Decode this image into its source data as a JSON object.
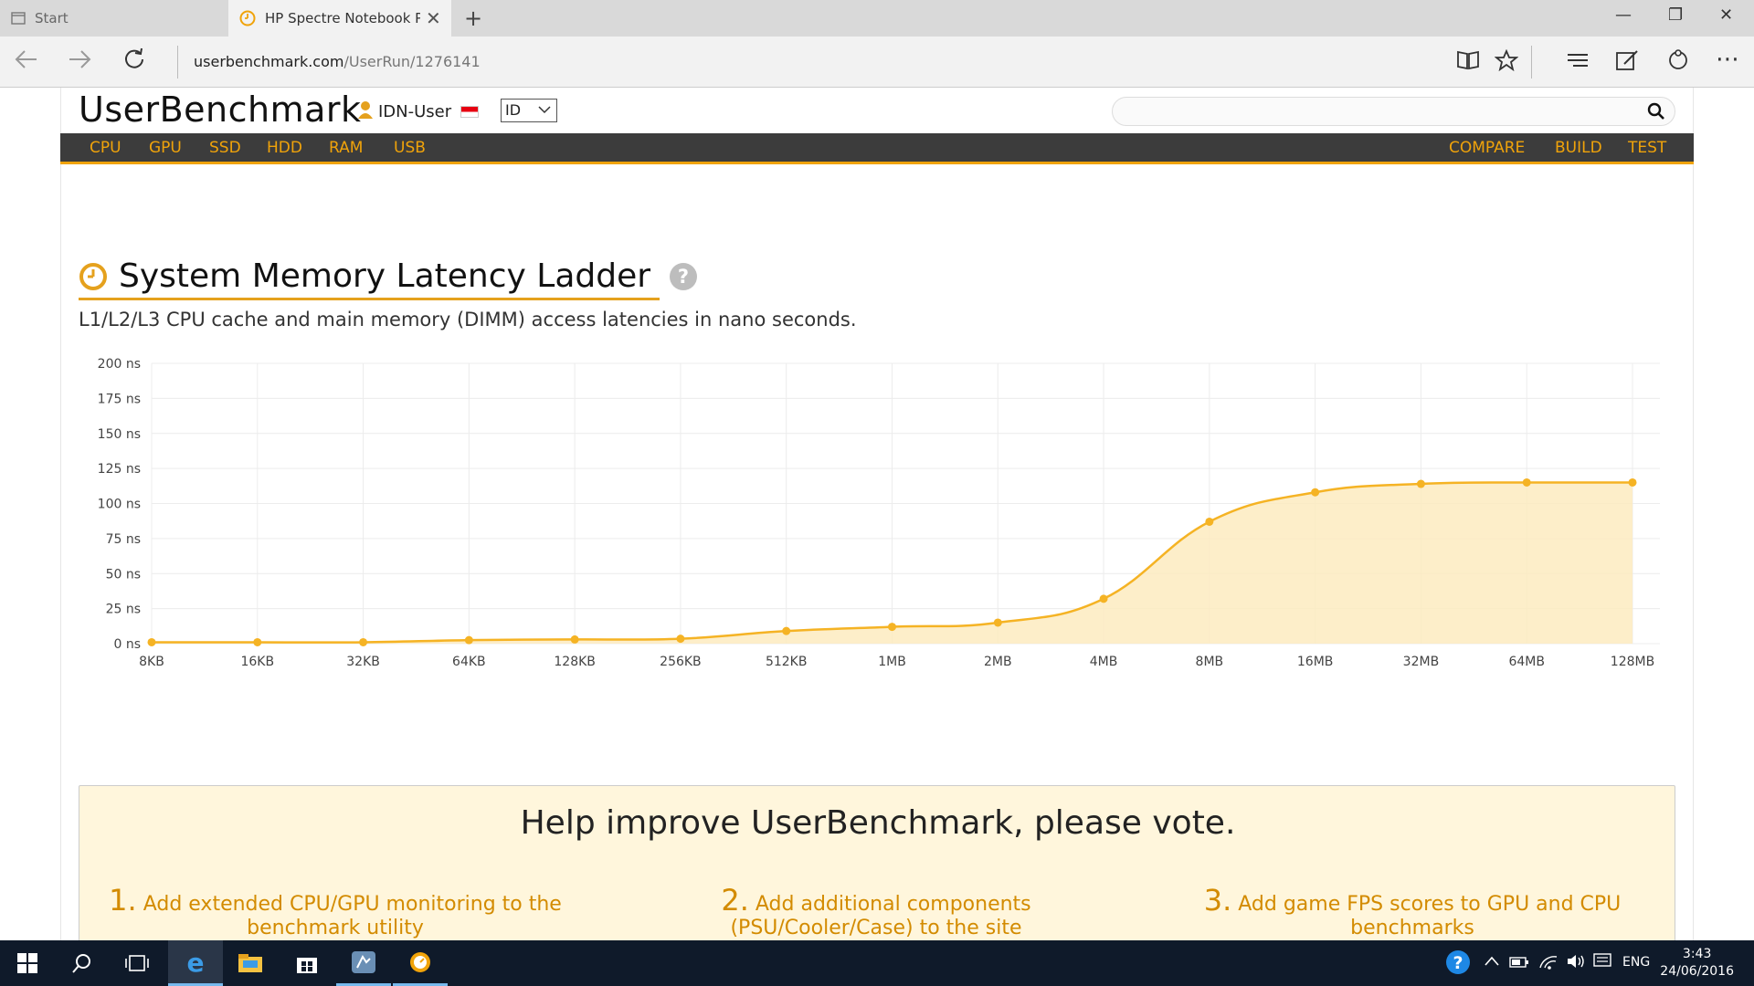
{
  "browser": {
    "tabs": [
      {
        "label": "Start"
      },
      {
        "label": "HP Spectre Notebook P"
      }
    ],
    "url_domain": "userbenchmark.com",
    "url_path": "/UserRun/1276141"
  },
  "site": {
    "logo": "UserBenchmark",
    "user": "IDN-User",
    "lang": "ID",
    "menu_left": [
      "CPU",
      "GPU",
      "SSD",
      "HDD",
      "RAM",
      "USB"
    ],
    "menu_right": [
      "COMPARE",
      "BUILD",
      "TEST"
    ]
  },
  "section": {
    "title": "System Memory Latency Ladder",
    "subtitle": "L1/L2/L3 CPU cache and main memory (DIMM) access latencies in nano seconds."
  },
  "chart_data": {
    "type": "area",
    "categories": [
      "8KB",
      "16KB",
      "32KB",
      "64KB",
      "128KB",
      "256KB",
      "512KB",
      "1MB",
      "2MB",
      "4MB",
      "8MB",
      "16MB",
      "32MB",
      "64MB",
      "128MB"
    ],
    "values": [
      1,
      1,
      1,
      2.5,
      3,
      3.5,
      9,
      12,
      15,
      32,
      87,
      108,
      114,
      115,
      115
    ],
    "ylim": [
      0,
      200
    ],
    "yticks": [
      "0 ns",
      "25 ns",
      "50 ns",
      "75 ns",
      "100 ns",
      "125 ns",
      "150 ns",
      "175 ns",
      "200 ns"
    ],
    "grid": true,
    "color": "#f5b324",
    "fill": "#fdebbf"
  },
  "vote": {
    "title": "Help improve UserBenchmark, please vote.",
    "items": [
      {
        "num": "1.",
        "text": "Add extended CPU/GPU monitoring to the benchmark utility"
      },
      {
        "num": "2.",
        "text": "Add additional components (PSU/Cooler/Case) to the site"
      },
      {
        "num": "3.",
        "text": "Add game FPS scores to GPU and CPU benchmarks"
      }
    ]
  },
  "taskbar": {
    "lang": "ENG",
    "time": "3:43",
    "date": "24/06/2016"
  }
}
